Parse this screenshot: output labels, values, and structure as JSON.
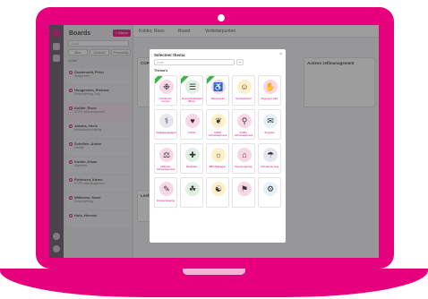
{
  "sidebar": {
    "title": "Boards",
    "new_button": "+ Nieuw",
    "search_placeholder": "Zoek",
    "tabs": [
      "Alles",
      "Gedeeld",
      "Persoonlijk"
    ],
    "filter": "Actief",
    "items": [
      {
        "name": "Oosterveld, Peter",
        "sub": "Werkgebied"
      },
      {
        "name": "Hoogeveen, Richard",
        "sub": "Samenwerking Zorg"
      },
      {
        "name": "Kolder, Roos",
        "sub": "COPD zelfmanagement"
      },
      {
        "name": "Jakobs, Henk",
        "sub": "Medicatiebeoordeling"
      },
      {
        "name": "Schellen, Anton",
        "sub": "Leefstijl"
      },
      {
        "name": "Kolder, Klaas",
        "sub": "Algemeen"
      },
      {
        "name": "Pietersen, Karen",
        "sub": "COPD zelfmanagement"
      },
      {
        "name": "Willemse, Karel",
        "sub": "Samenwerking"
      },
      {
        "name": "Huis, Hennek",
        "sub": ""
      }
    ]
  },
  "topbar": {
    "crumbs": [
      "Kolder, Roos",
      "Board",
      "Verbeterpunten"
    ]
  },
  "main": {
    "cards": [
      {
        "title": "COPD zelfmanagement"
      },
      {
        "title": "Leefstijl"
      },
      {
        "title": "Actieve zelfmanagement"
      }
    ]
  },
  "dialog": {
    "title": "Selecteer thema",
    "search_placeholder": "Zoek",
    "search_button": "⌕",
    "close": "×",
    "section": "Thema's",
    "themes": [
      {
        "label": "COVID-19 / Corona",
        "glyph": "❉",
        "color": "#f7d6e6",
        "badge": true
      },
      {
        "label": "Gezondheidsvaardigheden (BLG)",
        "glyph": "☰",
        "color": "#dff0e0",
        "badge": true
      },
      {
        "label": "Valpreventie",
        "glyph": "♿",
        "color": "#f7d6e6",
        "badge": true
      },
      {
        "label": "Eenzaamheid",
        "glyph": "☺",
        "color": "#fdf0c8",
        "badge": false
      },
      {
        "label": "Algemeen ADL",
        "glyph": "✋",
        "color": "#f7d6e6",
        "badge": false
      },
      {
        "label": "Inhalatiemanagement",
        "glyph": "⚕",
        "color": "#e6e6f0",
        "badge": false
      },
      {
        "label": "COPD",
        "glyph": "♥",
        "color": "#f7d6e6",
        "badge": false
      },
      {
        "label": "COPD zelfmanagement",
        "glyph": "❦",
        "color": "#fdf0c8",
        "badge": false
      },
      {
        "label": "COPD-zelfmanagement",
        "glyph": "⚲",
        "color": "#f7d6e6",
        "badge": false
      },
      {
        "label": "Zorgplan",
        "glyph": "✉",
        "color": "#e6f0f7",
        "badge": false
      },
      {
        "label": "Diabetes zelfmanagement",
        "glyph": "⚖",
        "color": "#f7d6e6",
        "badge": false
      },
      {
        "label": "Medicatie",
        "glyph": "✚",
        "color": "#dff0e0",
        "badge": false
      },
      {
        "label": "BEO Bijdragen",
        "glyph": "☼",
        "color": "#fdf0c8",
        "badge": false
      },
      {
        "label": "Woonomgeving",
        "glyph": "⌂",
        "color": "#f7d6e6",
        "badge": false
      },
      {
        "label": "Chronische zorg",
        "glyph": "☂",
        "color": "#e6e6f0",
        "badge": false
      },
      {
        "label": "Zorgverzekering",
        "glyph": "✎",
        "color": "#f7d6e6",
        "badge": false
      },
      {
        "label": "",
        "glyph": "☘",
        "color": "#dff0e0",
        "badge": false
      },
      {
        "label": "",
        "glyph": "☯",
        "color": "#fdf0c8",
        "badge": false
      },
      {
        "label": "",
        "glyph": "⚑",
        "color": "#f7d6e6",
        "badge": false
      },
      {
        "label": "",
        "glyph": "⚙",
        "color": "#e6f0f7",
        "badge": false
      }
    ]
  }
}
